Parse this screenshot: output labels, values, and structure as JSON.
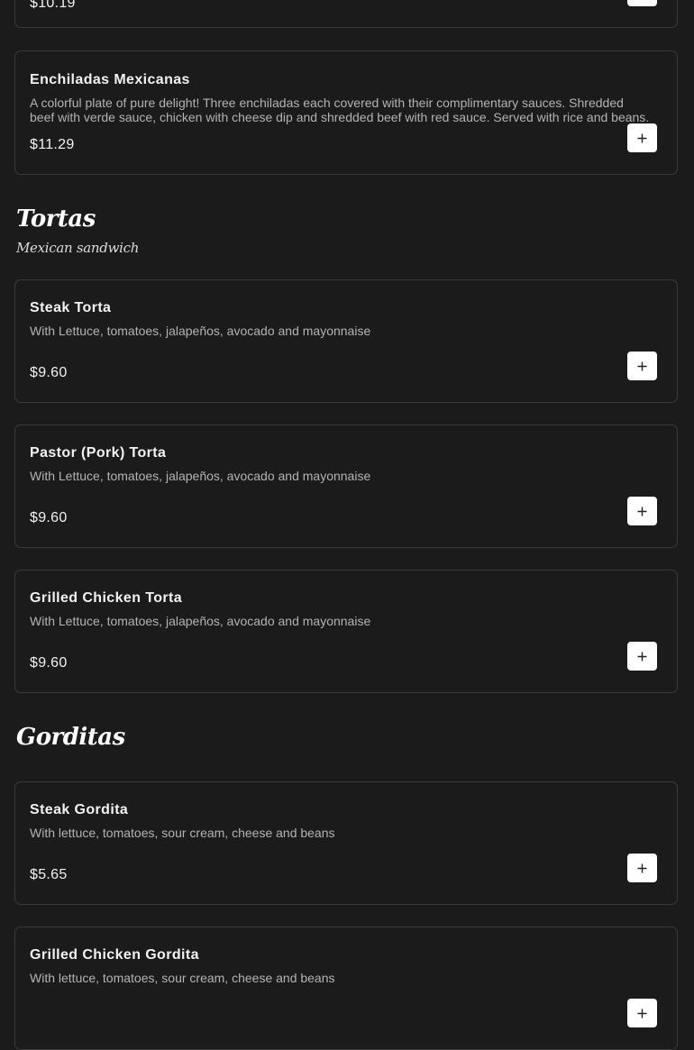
{
  "previous_item": {
    "price": "$10.19"
  },
  "enchiladas": {
    "name": "Enchiladas Mexicanas",
    "description": "A colorful plate of pure delight! Three enchiladas each covered with their complimentary sauces. Shredded beef with verde sauce, chicken with cheese dip and shredded beef with red sauce. Served with rice and beans.",
    "price": "$11.29"
  },
  "tortas": {
    "title": "Tortas",
    "subtitle": "Mexican sandwich",
    "items": [
      {
        "name": "Steak Torta",
        "description": "With Lettuce, tomatoes, jalapeños, avocado and mayonnaise",
        "price": "$9.60"
      },
      {
        "name": "Pastor (Pork) Torta",
        "description": "With Lettuce, tomatoes, jalapeños, avocado and mayonnaise",
        "price": "$9.60"
      },
      {
        "name": "Grilled Chicken Torta",
        "description": "With Lettuce, tomatoes, jalapeños, avocado and mayonnaise",
        "price": "$9.60"
      }
    ]
  },
  "gorditas": {
    "title": "Gorditas",
    "items": [
      {
        "name": "Steak Gordita",
        "description": "With lettuce, tomatoes, sour cream, cheese and beans",
        "price": "$5.65"
      },
      {
        "name": "Grilled Chicken Gordita",
        "description": "With lettuce, tomatoes, sour cream, cheese and beans"
      }
    ]
  },
  "icons": {
    "add": "plus-icon"
  },
  "colors": {
    "background": "#1b1b1b",
    "card_border": "#3b3b3b",
    "button": "#ffffff"
  }
}
